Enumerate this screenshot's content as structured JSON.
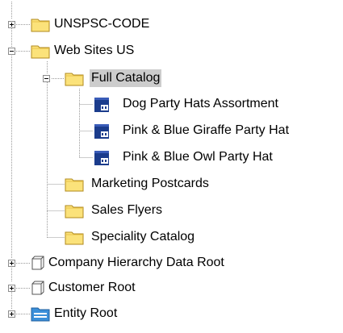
{
  "tree": {
    "items": [
      {
        "label": "UNSPSC-CODE",
        "icon": "folder-icon",
        "state": "collapsed"
      },
      {
        "label": "Web Sites US",
        "icon": "folder-icon",
        "state": "expanded"
      },
      {
        "label": "Full Catalog",
        "icon": "folder-icon",
        "state": "expanded",
        "selected": true
      },
      {
        "label": "Dog Party Hats Assortment",
        "icon": "product-icon"
      },
      {
        "label": "Pink & Blue Giraffe Party Hat",
        "icon": "product-icon"
      },
      {
        "label": "Pink & Blue Owl Party Hat",
        "icon": "product-icon"
      },
      {
        "label": "Marketing Postcards",
        "icon": "folder-icon"
      },
      {
        "label": "Sales Flyers",
        "icon": "folder-icon"
      },
      {
        "label": "Speciality Catalog",
        "icon": "folder-icon"
      },
      {
        "label": "Company Hierarchy Data Root",
        "icon": "hierarchy-root-icon",
        "state": "collapsed"
      },
      {
        "label": "Customer Root",
        "icon": "hierarchy-root-icon",
        "state": "collapsed"
      },
      {
        "label": "Entity Root",
        "icon": "entity-root-icon",
        "state": "collapsed"
      }
    ]
  },
  "colors": {
    "folder_fill": "#fbe27a",
    "folder_stroke": "#b08a1e",
    "product_fill": "#1b3c8c",
    "selection": "#cccccc",
    "tree_lines": "#9a9a9a",
    "entity_icon": "#3b8fd9"
  }
}
